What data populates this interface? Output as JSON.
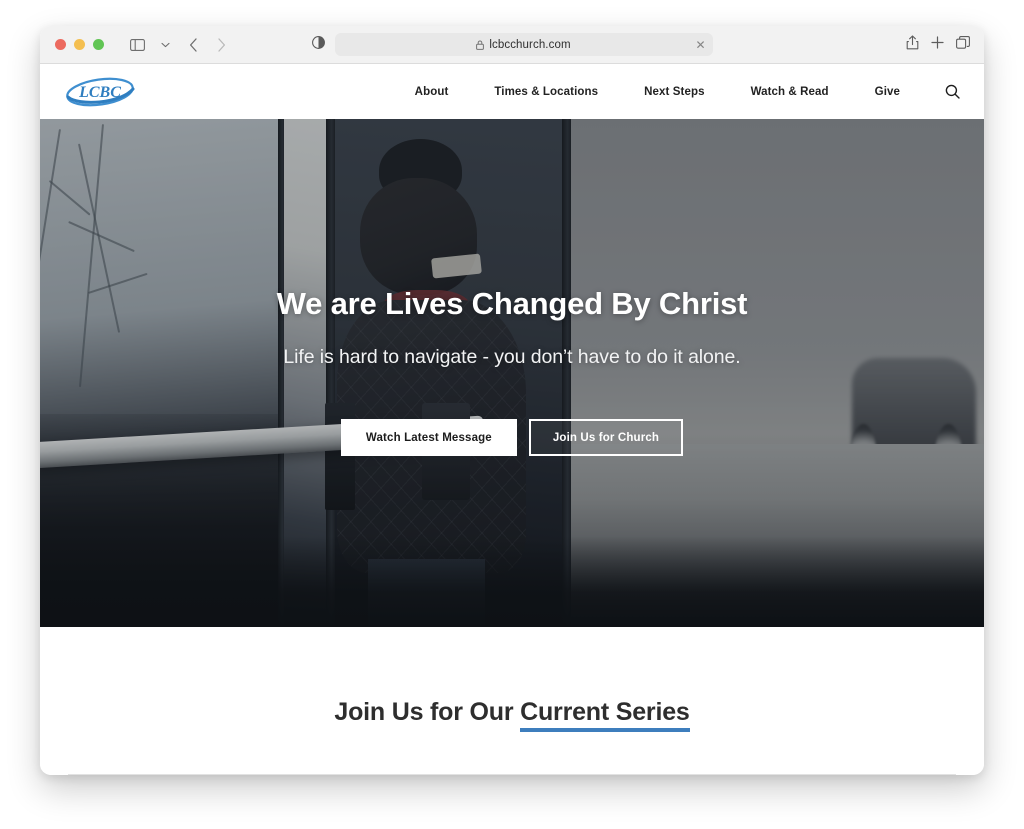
{
  "browser": {
    "traffic_lights": [
      "close",
      "minimize",
      "maximize"
    ],
    "sidebar_icon": "sidebar-icon",
    "chevron_icon": "chevron-down-icon",
    "back_icon": "back-arrow-icon",
    "forward_icon": "forward-arrow-icon",
    "reader_icon": "reader-contrast-icon",
    "address": {
      "lock_icon": "lock-icon",
      "url": "lcbcchurch.com",
      "clear": "✕"
    },
    "right_icons": [
      "share-icon",
      "new-tab-icon",
      "tab-overview-icon"
    ]
  },
  "site": {
    "logo_text": "LCBC",
    "nav": [
      {
        "label": "About"
      },
      {
        "label": "Times & Locations"
      },
      {
        "label": "Next Steps"
      },
      {
        "label": "Watch & Read"
      },
      {
        "label": "Give"
      }
    ],
    "search_icon": "search-icon"
  },
  "hero": {
    "title": "We are Lives Changed By Christ",
    "subtitle": "Life is hard to navigate - you don’t have to do it alone.",
    "buttons": [
      {
        "label": "Watch Latest Message",
        "style": "primary"
      },
      {
        "label": "Join Us for Church",
        "style": "outline"
      }
    ]
  },
  "series": {
    "title_lead": "Join Us for Our ",
    "title_accent": "Current Series",
    "accent_color": "#3d7ebd"
  }
}
